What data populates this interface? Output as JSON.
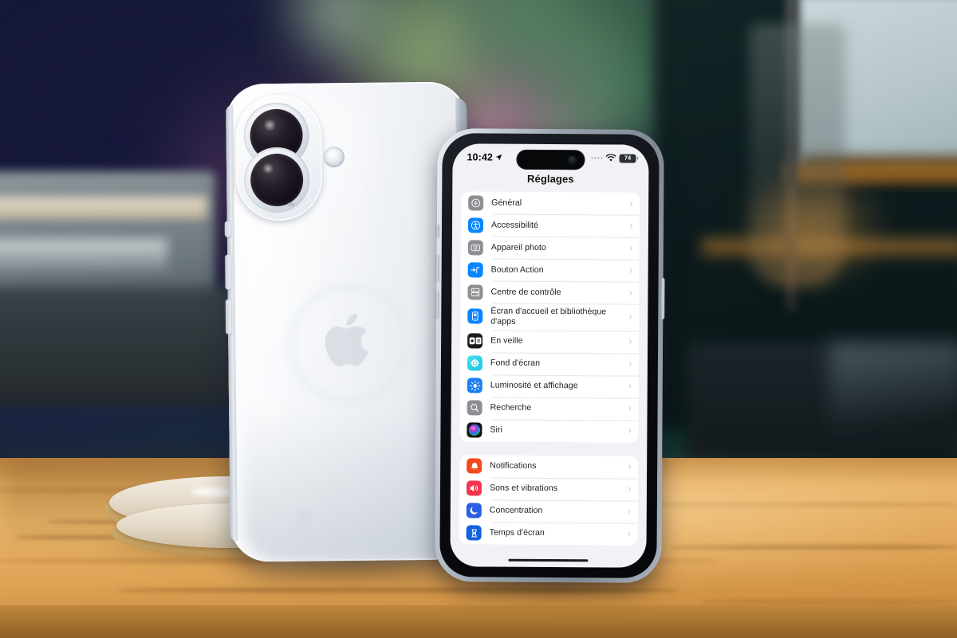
{
  "scene": {
    "description": "Two iPhones on a wooden table; white iPhone 16 rear view and black iPhone showing the iOS Settings app in French",
    "colors": {
      "background_navy": "#1b2045",
      "background_pink_glow": "#e88cbe",
      "background_green": "#80a86c",
      "background_teal": "#10322e",
      "table_wood": "#e9b46a",
      "phone_white_body": "#f3f5f8",
      "phone_black_frame": "#9aa4af",
      "ios_list_background": "#f2f2f6",
      "ios_row_background": "#ffffff",
      "ios_separator": "#e6e6ea",
      "ios_chevron": "#c2c2c7",
      "ios_label": "#1c1c1e"
    }
  },
  "phone_white": {
    "name": "iphone-white-rear",
    "camera_lens_count": 2,
    "has_flash": true,
    "has_apple_logo": true
  },
  "phone_black": {
    "name": "iphone-black-front",
    "status_bar": {
      "time": "10:42",
      "location_icon": "location-arrow-icon",
      "signal_icon": "cellular-signal-icon",
      "wifi_icon": "wifi-icon",
      "battery_level": "74",
      "battery_icon": "battery-icon"
    },
    "nav": {
      "title": "Réglages"
    },
    "groups": [
      {
        "name": "system-group",
        "rows": [
          {
            "label": "Général",
            "icon": "gear-icon",
            "icon_color": "#8e8e93",
            "chevron": "›"
          },
          {
            "label": "Accessibilité",
            "icon": "accessibility-icon",
            "icon_color": "#0a84ff",
            "chevron": "›"
          },
          {
            "label": "Appareil photo",
            "icon": "camera-icon",
            "icon_color": "#8e8e93",
            "chevron": "›"
          },
          {
            "label": "Bouton Action",
            "icon": "action-button-icon",
            "icon_color": "#0a84ff",
            "chevron": "›"
          },
          {
            "label": "Centre de contrôle",
            "icon": "control-center-icon",
            "icon_color": "#8e8e93",
            "chevron": "›"
          },
          {
            "label": "Écran d'accueil et bibliothèque d'apps",
            "icon": "home-screen-icon",
            "icon_color": "#0a84ff",
            "chevron": "›"
          },
          {
            "label": "En veille",
            "icon": "standby-icon",
            "icon_color": "#1c1c1e",
            "chevron": "›"
          },
          {
            "label": "Fond d'écran",
            "icon": "wallpaper-icon",
            "icon_color": "#30d5e8",
            "chevron": "›"
          },
          {
            "label": "Luminosité et affichage",
            "icon": "brightness-icon",
            "icon_color": "#0a84ff",
            "chevron": "›"
          },
          {
            "label": "Recherche",
            "icon": "search-icon",
            "icon_color": "#8e8e93",
            "chevron": "›"
          },
          {
            "label": "Siri",
            "icon": "siri-icon",
            "icon_color": "#d63aa0",
            "chevron": "›"
          }
        ]
      },
      {
        "name": "notifications-group",
        "rows": [
          {
            "label": "Notifications",
            "icon": "bell-icon",
            "icon_color": "#f4491f",
            "chevron": "›"
          },
          {
            "label": "Sons et vibrations",
            "icon": "speaker-icon",
            "icon_color": "#f2344d",
            "chevron": "›"
          },
          {
            "label": "Concentration",
            "icon": "moon-icon",
            "icon_color": "#2b5fe3",
            "chevron": "›"
          },
          {
            "label": "Temps d'écran",
            "icon": "hourglass-icon",
            "icon_color": "#1262e0",
            "chevron": "›"
          }
        ]
      }
    ],
    "home_indicator": "home-indicator"
  }
}
